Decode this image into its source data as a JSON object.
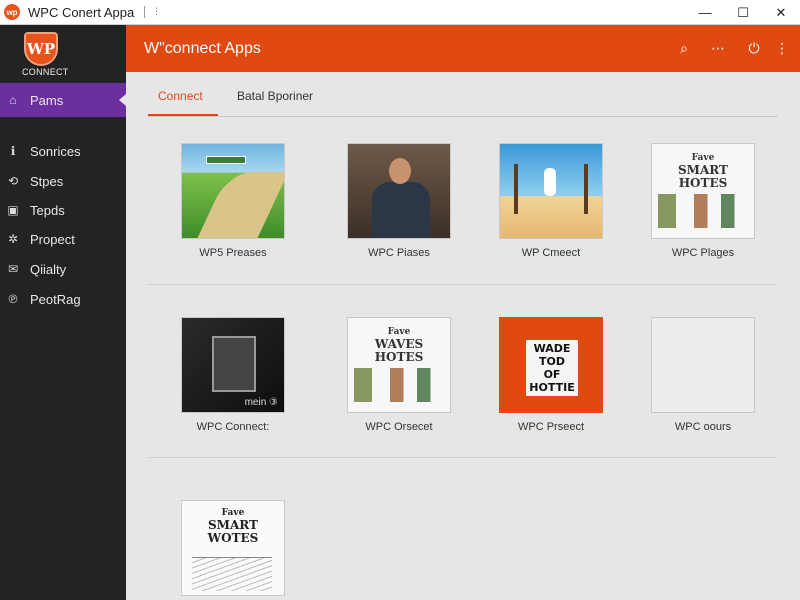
{
  "window": {
    "title": "WPC Conert Appa",
    "badge": "wp",
    "pin_glyph": "⫶",
    "min_glyph": "—",
    "max_glyph": "☐",
    "close_glyph": "✕"
  },
  "sidebar": {
    "logo_text": "CONNECT",
    "logo_mark": "WP",
    "items": [
      {
        "label": "Pams",
        "icon": "home-icon",
        "glyph": "⌂",
        "active": true
      },
      {
        "label": "Sonrices",
        "icon": "info-icon",
        "glyph": "ℹ"
      },
      {
        "label": "Stpes",
        "icon": "steps-icon",
        "glyph": "⟲"
      },
      {
        "label": "Tepds",
        "icon": "image-icon",
        "glyph": "▣"
      },
      {
        "label": "Propect",
        "icon": "gear-icon",
        "glyph": "✲"
      },
      {
        "label": "Qiialty",
        "icon": "mail-icon",
        "glyph": "✉"
      },
      {
        "label": "PeotRag",
        "icon": "pinterest-icon",
        "glyph": "℗"
      }
    ]
  },
  "header": {
    "title": "W\"connect Apps",
    "icons": {
      "search": "⌕",
      "dash": "⋯",
      "power": "⏻",
      "more": "⋮"
    }
  },
  "tabs": [
    {
      "label": "Connect",
      "active": true
    },
    {
      "label": "Batal Bporiner",
      "active": false
    }
  ],
  "tiles": [
    {
      "caption": "WP5 Preases"
    },
    {
      "caption": "WPC Piases"
    },
    {
      "caption": "WP Cmeect"
    },
    {
      "caption": "WPC Plages",
      "art": [
        "Fave",
        "SMART",
        "HOTES"
      ]
    },
    {
      "caption": "WPC Connect:",
      "art_mark": "mein ③"
    },
    {
      "caption": "WPC Orsecet",
      "art": [
        "Fave",
        "WAVES",
        "HOTES"
      ]
    },
    {
      "caption": "WPC Prseect",
      "art": [
        "WADE",
        "TOD",
        "OF",
        "HOTTIE"
      ]
    },
    {
      "caption": "WPC oours"
    },
    {
      "caption": "",
      "art": [
        "Fave",
        "SMART",
        "WOTES"
      ]
    }
  ],
  "colors": {
    "accent": "#e04a12",
    "sidebar_active": "#6b2fa0",
    "sidebar_bg": "#232323"
  }
}
